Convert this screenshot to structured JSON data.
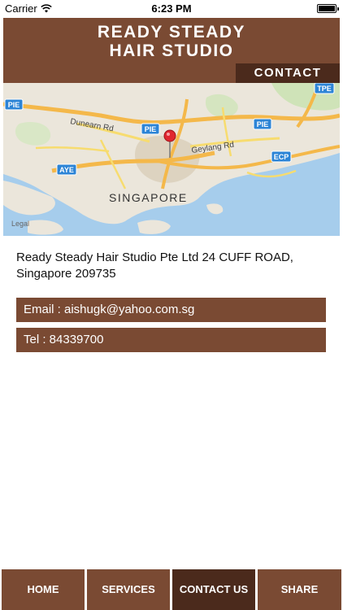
{
  "status_bar": {
    "carrier": "Carrier",
    "time": "6:23 PM",
    "icons": [
      "wifi-icon",
      "battery-icon"
    ]
  },
  "header": {
    "brand_line1": "READY STEADY",
    "brand_line2": "HAIR STUDIO",
    "page_tag": "CONTACT",
    "background_color": "#7a4a33",
    "tag_color": "#4b2a1c"
  },
  "map": {
    "labels": {
      "pie_1": "PIE",
      "pie_2": "PIE",
      "pie_3": "PIE",
      "tpe": "TPE",
      "aye": "AYE",
      "ecp": "ECP",
      "dunearn": "Dunearn Rd",
      "geylang": "Geylang Rd",
      "city": "SINGAPORE",
      "legal": "Legal"
    },
    "pin_icon": "map-pin-icon"
  },
  "contact": {
    "address": "Ready Steady Hair Studio Pte Ltd 24 CUFF ROAD, Singapore 209735",
    "email": "Email : aishugk@yahoo.com.sg",
    "tel": "Tel : 84339700"
  },
  "nav": {
    "home": "HOME",
    "services": "SERVICES",
    "contact": "CONTACT US",
    "share": "SHARE",
    "active": "CONTACT US"
  }
}
